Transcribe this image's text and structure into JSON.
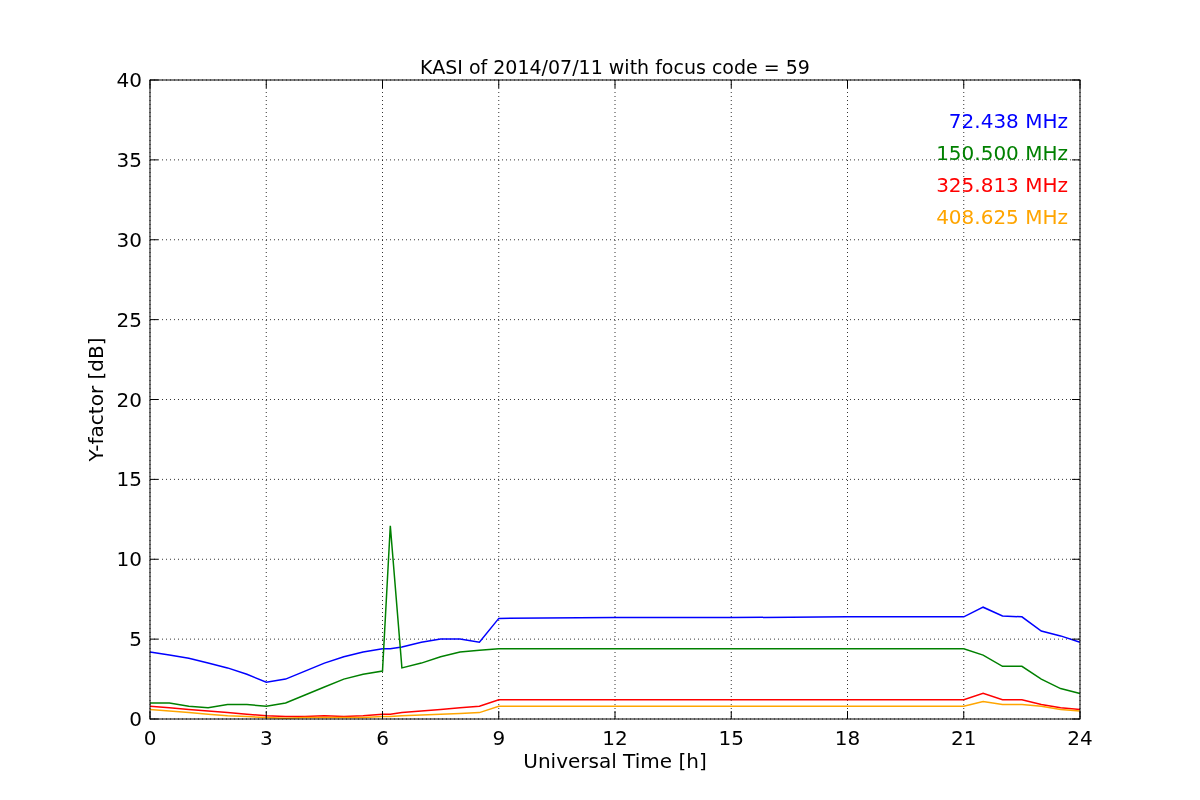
{
  "chart_data": {
    "type": "line",
    "title": "KASI of 2014/07/11 with focus code = 59",
    "xlabel": "Universal Time [h]",
    "ylabel": "Y-factor [dB]",
    "x": [
      0,
      0.5,
      1,
      1.5,
      2,
      2.5,
      3,
      3.5,
      4,
      4.5,
      5,
      5.5,
      6,
      6.2,
      6.5,
      7,
      7.5,
      8,
      8.5,
      9,
      12,
      15,
      18,
      21,
      21.5,
      22,
      22.5,
      23,
      23.5,
      24
    ],
    "series": [
      {
        "name": "72.438 MHz",
        "color": "#0000ff",
        "values": [
          4.2,
          4.0,
          3.8,
          3.5,
          3.2,
          2.8,
          2.3,
          2.5,
          3.0,
          3.5,
          3.9,
          4.2,
          4.4,
          4.4,
          4.5,
          4.8,
          5.0,
          5.0,
          4.8,
          6.3,
          6.35,
          6.35,
          6.4,
          6.4,
          7.0,
          6.45,
          6.4,
          5.5,
          5.2,
          4.8
        ]
      },
      {
        "name": "150.500 MHz",
        "color": "#008000",
        "values": [
          1.0,
          1.0,
          0.8,
          0.7,
          0.9,
          0.9,
          0.8,
          1.0,
          1.5,
          2.0,
          2.5,
          2.8,
          3.0,
          12.1,
          3.2,
          3.5,
          3.9,
          4.2,
          4.3,
          4.4,
          4.4,
          4.4,
          4.4,
          4.4,
          4.0,
          3.3,
          3.3,
          2.5,
          1.9,
          1.6
        ]
      },
      {
        "name": "325.813 MHz",
        "color": "#ff0000",
        "values": [
          0.8,
          0.7,
          0.6,
          0.5,
          0.4,
          0.3,
          0.2,
          0.15,
          0.15,
          0.2,
          0.15,
          0.2,
          0.3,
          0.3,
          0.4,
          0.5,
          0.6,
          0.7,
          0.8,
          1.2,
          1.2,
          1.2,
          1.2,
          1.2,
          1.6,
          1.2,
          1.2,
          0.9,
          0.7,
          0.6
        ]
      },
      {
        "name": "408.625 MHz",
        "color": "#ffa500",
        "values": [
          0.6,
          0.5,
          0.4,
          0.3,
          0.2,
          0.15,
          0.1,
          0.05,
          0.1,
          0.1,
          0.1,
          0.1,
          0.15,
          0.15,
          0.2,
          0.25,
          0.3,
          0.35,
          0.4,
          0.8,
          0.8,
          0.8,
          0.8,
          0.8,
          1.1,
          0.9,
          0.9,
          0.8,
          0.6,
          0.5
        ]
      }
    ],
    "xlim": [
      0,
      24
    ],
    "ylim": [
      0,
      40
    ],
    "xticks": [
      0,
      3,
      6,
      9,
      12,
      15,
      18,
      21,
      24
    ],
    "yticks": [
      0,
      5,
      10,
      15,
      20,
      25,
      30,
      35,
      40
    ],
    "grid": true
  }
}
